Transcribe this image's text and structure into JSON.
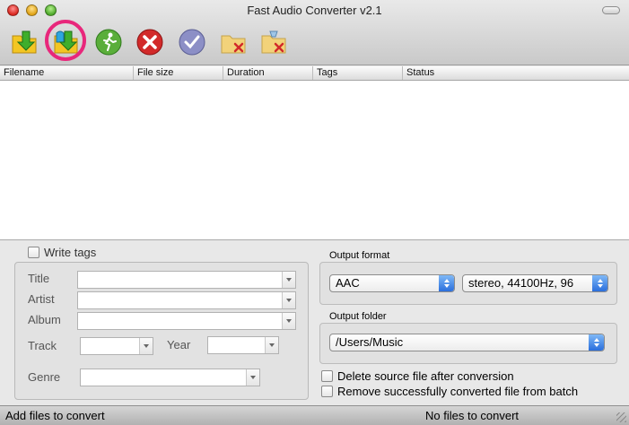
{
  "window": {
    "title": "Fast Audio Converter v2.1"
  },
  "toolbar": {
    "items": [
      {
        "name": "add-files-icon",
        "color": "#f3c623"
      },
      {
        "name": "add-folder-icon",
        "color": "#2ea6de"
      },
      {
        "name": "convert-run-icon",
        "color": "#5aae3a"
      },
      {
        "name": "cancel-icon",
        "color": "#d22a2a"
      },
      {
        "name": "check-icon",
        "color": "#8c8fc6"
      },
      {
        "name": "remove-file-icon",
        "color": "#f2d27a"
      },
      {
        "name": "clear-files-icon",
        "color": "#f2d27a"
      }
    ],
    "highlight_color": "#e8277b"
  },
  "table": {
    "columns": [
      "Filename",
      "File size",
      "Duration",
      "Tags",
      "Status"
    ],
    "rows": []
  },
  "tags": {
    "write_tags_label": "Write tags",
    "write_tags_checked": false,
    "title_label": "Title",
    "artist_label": "Artist",
    "album_label": "Album",
    "track_label": "Track",
    "year_label": "Year",
    "genre_label": "Genre"
  },
  "output_format": {
    "label": "Output format",
    "format_value": "AAC",
    "quality_value": "stereo, 44100Hz, 96"
  },
  "output_folder": {
    "label": "Output folder",
    "path_value": "/Users/Music"
  },
  "options": {
    "delete_source_label": "Delete source file after conversion",
    "delete_source_checked": false,
    "remove_converted_label": "Remove successfully converted file from batch",
    "remove_converted_checked": false
  },
  "status": {
    "left": "Add files to convert",
    "right": "No files to convert"
  }
}
